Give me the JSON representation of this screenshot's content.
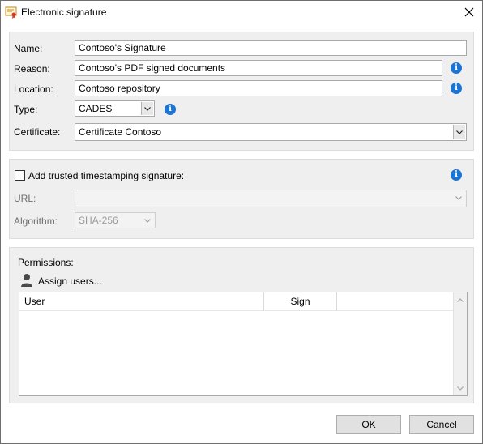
{
  "window": {
    "title": "Electronic signature"
  },
  "general": {
    "name_label": "Name:",
    "name_value": "Contoso's Signature",
    "reason_label": "Reason:",
    "reason_value": "Contoso's PDF signed documents",
    "location_label": "Location:",
    "location_value": "Contoso repository",
    "type_label": "Type:",
    "type_value": "CADES",
    "certificate_label": "Certificate:",
    "certificate_value": "Certificate Contoso"
  },
  "timestamp": {
    "checkbox_label": "Add trusted timestamping signature:",
    "checked": false,
    "url_label": "URL:",
    "url_value": "",
    "algorithm_label": "Algorithm:",
    "algorithm_value": "SHA-256"
  },
  "permissions": {
    "label": "Permissions:",
    "assign_label": "Assign users...",
    "columns": [
      "User",
      "Sign"
    ],
    "rows": []
  },
  "buttons": {
    "ok": "OK",
    "cancel": "Cancel"
  },
  "icons": {
    "app": "certificate-icon",
    "close": "close-icon",
    "info": "info-icon",
    "user": "user-icon",
    "dropdown": "chevron-down-icon"
  },
  "colors": {
    "info_blue": "#1b74d4",
    "panel_bg": "#efefef",
    "button_bg": "#e1e1e1"
  }
}
